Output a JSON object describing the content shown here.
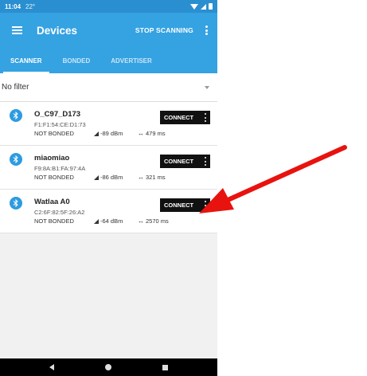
{
  "status_bar": {
    "time": "11:04",
    "temp": "22°"
  },
  "app_bar": {
    "title": "Devices",
    "stop_label": "STOP SCANNING"
  },
  "tabs": [
    {
      "label": "SCANNER",
      "active": true
    },
    {
      "label": "BONDED",
      "active": false
    },
    {
      "label": "ADVERTISER",
      "active": false
    }
  ],
  "filter": {
    "label": "No filter"
  },
  "devices": [
    {
      "name": "O_C97_D173",
      "address": "F1:F1:54:CE:D1:73",
      "bond": "NOT BONDED",
      "rssi": "-89 dBm",
      "interval": "479 ms",
      "connect_label": "CONNECT"
    },
    {
      "name": "miaomiao",
      "address": "F9:8A:B1:FA:97:4A",
      "bond": "NOT BONDED",
      "rssi": "-86 dBm",
      "interval": "321 ms",
      "connect_label": "CONNECT"
    },
    {
      "name": "Watlaa A0",
      "address": "C2:6F:82:5F:26:A2",
      "bond": "NOT BONDED",
      "rssi": "-64 dBm",
      "interval": "2570 ms",
      "connect_label": "CONNECT"
    }
  ],
  "colors": {
    "primary": "#35a2e2",
    "status_bar": "#2a8fd0",
    "annotation_arrow": "#e8130e",
    "bluetooth_icon": "#2d9be0"
  },
  "icons": {
    "menu": "hamburger-icon",
    "more": "kebab-icon",
    "bluetooth": "bluetooth-icon",
    "rssi": "signal-icon",
    "interval": "double-arrow-icon"
  }
}
